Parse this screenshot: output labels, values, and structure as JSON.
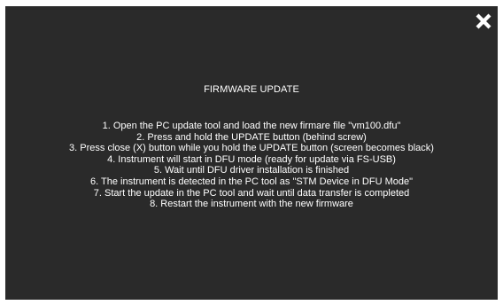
{
  "dialog": {
    "title": "FIRMWARE UPDATE",
    "close_icon": "close-x-icon",
    "background_color": "#2a2a2a",
    "text_color": "#ffffff",
    "steps": [
      "1. Open the PC update tool and load the new firmare file \"vm100.dfu\"",
      "2. Press and hold the UPDATE button (behind screw)",
      "3. Press close (X) button while you hold the UPDATE button (screen becomes black)",
      "4. Instrument will start in DFU mode (ready for update via FS-USB)",
      "5. Wait until DFU driver installation is finished",
      "6. The instrument is detected in the PC tool as \"STM Device in DFU Mode\"",
      "7. Start the update in the PC tool and wait until data transfer is completed",
      "8. Restart the instrument with the new firmware"
    ]
  }
}
